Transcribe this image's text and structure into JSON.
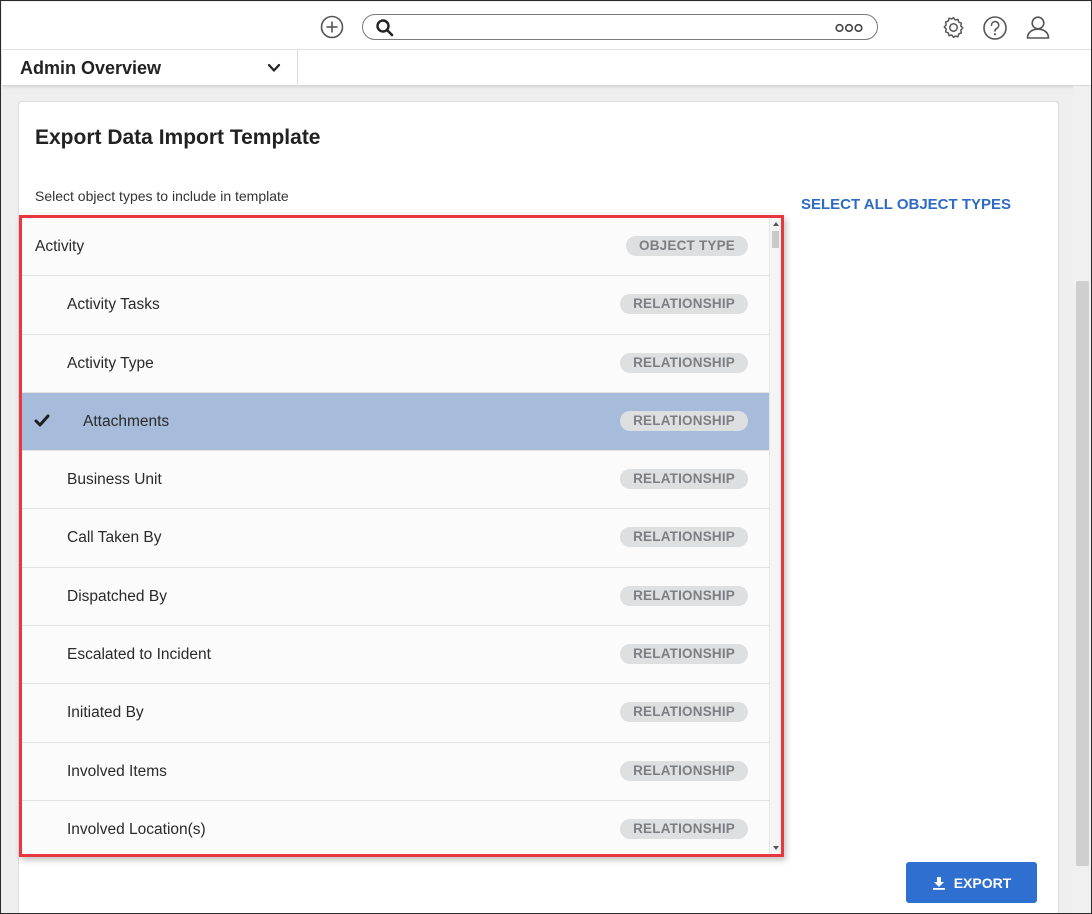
{
  "header": {
    "search_placeholder": "",
    "icons": [
      "plus-circle-icon",
      "search-icon",
      "more-icon",
      "gear-icon",
      "help-icon",
      "user-icon"
    ]
  },
  "nav": {
    "dashboard_label": "Admin Overview"
  },
  "page": {
    "title": "Export Data Import Template",
    "instruction": "Select object types to include in template",
    "select_all_label": "SELECT ALL OBJECT TYPES",
    "export_label": "EXPORT"
  },
  "list": {
    "rows": [
      {
        "name": "Activity",
        "badge": "OBJECT TYPE",
        "level": 0,
        "selected": false
      },
      {
        "name": "Activity Tasks",
        "badge": "RELATIONSHIP",
        "level": 1,
        "selected": false
      },
      {
        "name": "Activity Type",
        "badge": "RELATIONSHIP",
        "level": 1,
        "selected": false
      },
      {
        "name": "Attachments",
        "badge": "RELATIONSHIP",
        "level": 1,
        "selected": true
      },
      {
        "name": "Business Unit",
        "badge": "RELATIONSHIP",
        "level": 1,
        "selected": false
      },
      {
        "name": "Call Taken By",
        "badge": "RELATIONSHIP",
        "level": 1,
        "selected": false
      },
      {
        "name": "Dispatched By",
        "badge": "RELATIONSHIP",
        "level": 1,
        "selected": false
      },
      {
        "name": "Escalated to Incident",
        "badge": "RELATIONSHIP",
        "level": 1,
        "selected": false
      },
      {
        "name": "Initiated By",
        "badge": "RELATIONSHIP",
        "level": 1,
        "selected": false
      },
      {
        "name": "Involved Items",
        "badge": "RELATIONSHIP",
        "level": 1,
        "selected": false
      },
      {
        "name": "Involved Location(s)",
        "badge": "RELATIONSHIP",
        "level": 1,
        "selected": false
      }
    ]
  },
  "colors": {
    "accent": "#2f6fd0",
    "link": "#2d6bc4",
    "selected_row": "#a7bcdb",
    "highlight_border": "#e8383d",
    "badge_bg": "#dedfe1",
    "badge_text": "#7b7f84"
  }
}
